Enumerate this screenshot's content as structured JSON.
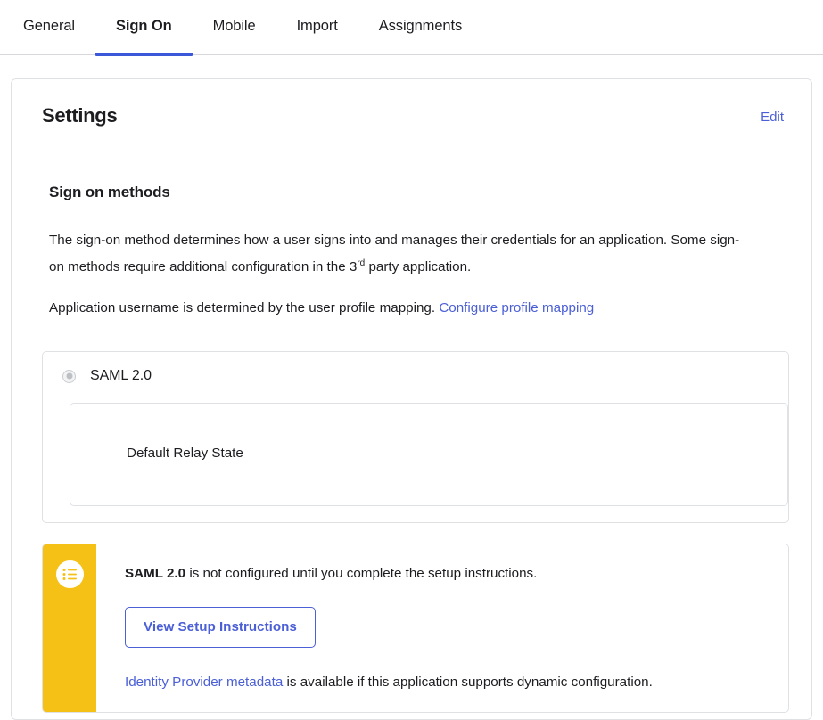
{
  "tabs": [
    {
      "label": "General",
      "active": false
    },
    {
      "label": "Sign On",
      "active": true
    },
    {
      "label": "Mobile",
      "active": false
    },
    {
      "label": "Import",
      "active": false
    },
    {
      "label": "Assignments",
      "active": false
    }
  ],
  "card": {
    "title": "Settings",
    "edit_label": "Edit",
    "section_title": "Sign on methods",
    "paragraph_1_part_1": "The sign-on method determines how a user signs into and manages their credentials for an application. Some sign-on methods require additional configuration in the 3",
    "paragraph_1_sup": "rd",
    "paragraph_1_part_2": " party application.",
    "paragraph_2_text": "Application username is determined by the user profile mapping. ",
    "paragraph_2_link": "Configure profile mapping"
  },
  "option": {
    "radio_label": "SAML 2.0",
    "radio_state": "selected-disabled",
    "relay_label": "Default Relay State"
  },
  "alert": {
    "icon": "instructions-list-icon",
    "stripe_color": "#F5C116",
    "bold_prefix": "SAML 2.0",
    "message": " is not configured until you complete the setup instructions.",
    "button_label": "View Setup Instructions",
    "metadata_link": "Identity Provider metadata",
    "metadata_rest": " is available if this application supports dynamic configuration."
  },
  "colors": {
    "accent_blue": "#4B5FD6",
    "tab_underline": "#3B58D9",
    "alert_yellow": "#F5C116",
    "text": "#1D1D21",
    "border": "#DFE1E4"
  }
}
